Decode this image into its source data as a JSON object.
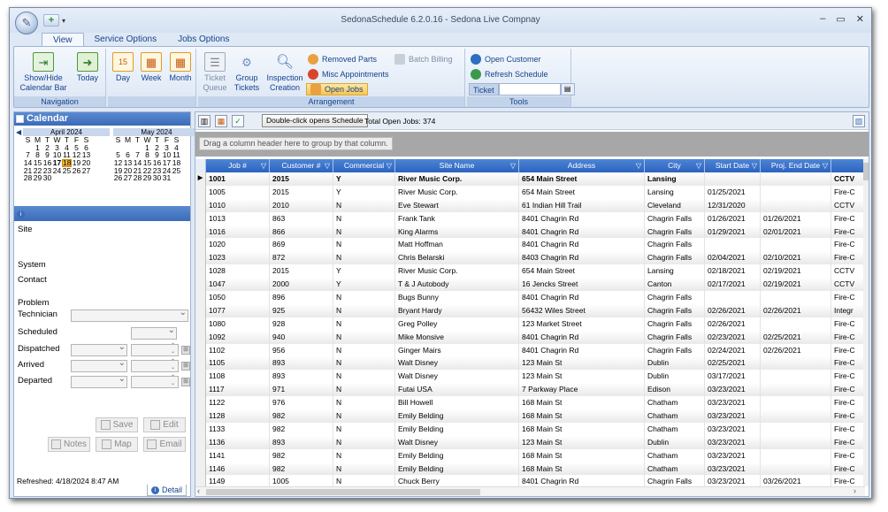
{
  "window": {
    "title": "SedonaSchedule 6.2.0.16 - Sedona Live Compnay"
  },
  "tabs": [
    "View",
    "Service Options",
    "Jobs Options"
  ],
  "ribbon": {
    "navigation": {
      "label": "Navigation",
      "show_hide_calendar": "Show/Hide Calendar Bar",
      "today": "Today"
    },
    "views": {
      "day": "Day",
      "week": "Week",
      "month": "Month"
    },
    "arrangement": {
      "label": "Arrangement",
      "ticket_queue": "Ticket Queue",
      "group_tickets": "Group Tickets",
      "inspection_creation": "Inspection Creation",
      "removed_parts": "Removed Parts",
      "misc_appointments": "Misc Appointments",
      "open_jobs": "Open Jobs",
      "batch_billing": "Batch Billing"
    },
    "tools": {
      "label": "Tools",
      "open_customer": "Open Customer",
      "refresh_schedule": "Refresh Schedule",
      "ticket_label": "Ticket",
      "ticket_value": ""
    }
  },
  "calendar": {
    "title": "Calendar",
    "months": [
      {
        "name": "April 2024",
        "days_header": [
          "S",
          "M",
          "T",
          "W",
          "T",
          "F",
          "S"
        ],
        "weeks": [
          [
            "",
            "1",
            "2",
            "3",
            "4",
            "5",
            "6"
          ],
          [
            "7",
            "8",
            "9",
            "10",
            "11",
            "12",
            "13"
          ],
          [
            "14",
            "15",
            "16",
            "17",
            "18",
            "19",
            "20"
          ],
          [
            "21",
            "22",
            "23",
            "24",
            "25",
            "26",
            "27"
          ],
          [
            "28",
            "29",
            "30",
            "",
            "",
            "",
            ""
          ]
        ]
      },
      {
        "name": "May 2024",
        "days_header": [
          "S",
          "M",
          "T",
          "W",
          "T",
          "F",
          "S"
        ],
        "weeks": [
          [
            "",
            "",
            "",
            "1",
            "2",
            "3",
            "4"
          ],
          [
            "5",
            "6",
            "7",
            "8",
            "9",
            "10",
            "11"
          ],
          [
            "12",
            "13",
            "14",
            "15",
            "16",
            "17",
            "18"
          ],
          [
            "19",
            "20",
            "21",
            "22",
            "23",
            "24",
            "25"
          ],
          [
            "26",
            "27",
            "28",
            "29",
            "30",
            "31",
            ""
          ]
        ]
      }
    ],
    "today": "18"
  },
  "detail": {
    "site_label": "Site",
    "system_label": "System",
    "contact_label": "Contact",
    "problem_label": "Problem",
    "technician_label": "Technician",
    "scheduled_label": "Scheduled",
    "dispatched_label": "Dispatched",
    "arrived_label": "Arrived",
    "departed_label": "Departed",
    "save": "Save",
    "edit": "Edit",
    "notes": "Notes",
    "map": "Map",
    "email": "Email",
    "refreshed": "Refreshed: 4/18/2024 8:47 AM",
    "detail_tab": "Detail"
  },
  "jobs": {
    "double_click_label": "Double-click opens Schedule",
    "total_open_jobs": "Total Open Jobs: 374",
    "group_hint": "Drag a column header here to group by that column.",
    "columns": [
      "Job #",
      "Customer #",
      "Commercial",
      "Site Name",
      "Address",
      "City",
      "Start Date",
      "Proj. End Date",
      ""
    ],
    "rows": [
      [
        "1001",
        "2015",
        "Y",
        "River Music Corp.",
        "654 Main Street",
        "Lansing",
        "",
        "",
        "CCTV"
      ],
      [
        "1005",
        "2015",
        "Y",
        "River Music Corp.",
        "654 Main Street",
        "Lansing",
        "01/25/2021",
        "",
        "Fire-C"
      ],
      [
        "1010",
        "2010",
        "N",
        "Eve Stewart",
        "61 Indian Hill Trail",
        "Cleveland",
        "12/31/2020",
        "",
        "CCTV"
      ],
      [
        "1013",
        "863",
        "N",
        "Frank Tank",
        "8401 Chagrin Rd",
        "Chagrin Falls",
        "01/26/2021",
        "01/26/2021",
        "Fire-C"
      ],
      [
        "1016",
        "866",
        "N",
        "King Alarms",
        "8401 Chagrin Rd",
        "Chagrin Falls",
        "01/29/2021",
        "02/01/2021",
        "Fire-C"
      ],
      [
        "1020",
        "869",
        "N",
        "Matt Hoffman",
        "8401 Chagrin Rd",
        "Chagrin Falls",
        "",
        "",
        "Fire-C"
      ],
      [
        "1023",
        "872",
        "N",
        "Chris Belarski",
        "8403 Chagrin Rd",
        "Chagrin Falls",
        "02/04/2021",
        "02/10/2021",
        "Fire-C"
      ],
      [
        "1028",
        "2015",
        "Y",
        "River Music Corp.",
        "654 Main Street",
        "Lansing",
        "02/18/2021",
        "02/19/2021",
        "CCTV"
      ],
      [
        "1047",
        "2000",
        "Y",
        "T & J Autobody",
        "16 Jencks Street",
        "Canton",
        "02/17/2021",
        "02/19/2021",
        "CCTV"
      ],
      [
        "1050",
        "896",
        "N",
        "Bugs Bunny",
        "8401 Chagrin Rd",
        "Chagrin Falls",
        "",
        "",
        "Fire-C"
      ],
      [
        "1077",
        "925",
        "N",
        "Bryant Hardy",
        "56432 Wiles Street",
        "Chagrin Falls",
        "02/26/2021",
        "02/26/2021",
        "Integr"
      ],
      [
        "1080",
        "928",
        "N",
        "Greg Polley",
        "123 Market Street",
        "Chagrin Falls",
        "02/26/2021",
        "",
        "Fire-C"
      ],
      [
        "1092",
        "940",
        "N",
        "Mike Monsive",
        "8401 Chagrin Rd",
        "Chagrin Falls",
        "02/23/2021",
        "02/25/2021",
        "Fire-C"
      ],
      [
        "1102",
        "956",
        "N",
        "Ginger Mairs",
        "8401 Chagrin Rd",
        "Chagrin Falls",
        "02/24/2021",
        "02/26/2021",
        "Fire-C"
      ],
      [
        "1105",
        "893",
        "N",
        "Walt Disney",
        "123 Main St",
        "Dublin",
        "02/25/2021",
        "",
        "Fire-C"
      ],
      [
        "1108",
        "893",
        "N",
        "Walt Disney",
        "123 Main St",
        "Dublin",
        "03/17/2021",
        "",
        "Fire-C"
      ],
      [
        "1117",
        "971",
        "N",
        "Futai USA",
        "7 Parkway Place",
        "Edison",
        "03/23/2021",
        "",
        "Fire-C"
      ],
      [
        "1122",
        "976",
        "N",
        "Bill Howell",
        "168 Main St",
        "Chatham",
        "03/23/2021",
        "",
        "Fire-C"
      ],
      [
        "1128",
        "982",
        "N",
        "Emily Belding",
        "168 Main St",
        "Chatham",
        "03/23/2021",
        "",
        "Fire-C"
      ],
      [
        "1133",
        "982",
        "N",
        "Emily Belding",
        "168 Main St",
        "Chatham",
        "03/23/2021",
        "",
        "Fire-C"
      ],
      [
        "1136",
        "893",
        "N",
        "Walt Disney",
        "123 Main St",
        "Dublin",
        "03/23/2021",
        "",
        "Fire-C"
      ],
      [
        "1141",
        "982",
        "N",
        "Emily Belding",
        "168 Main St",
        "Chatham",
        "03/23/2021",
        "",
        "Fire-C"
      ],
      [
        "1146",
        "982",
        "N",
        "Emily Belding",
        "168 Main St",
        "Chatham",
        "03/23/2021",
        "",
        "Fire-C"
      ],
      [
        "1149",
        "1005",
        "N",
        "Chuck Berry",
        "8401 Chagrin Rd",
        "Chagrin Falls",
        "03/23/2021",
        "03/26/2021",
        "Fire-C"
      ]
    ]
  },
  "colors": {
    "header_blue": "#2c64bf",
    "ribbon_text": "#15428b",
    "today_highlight": "#f7b733"
  }
}
